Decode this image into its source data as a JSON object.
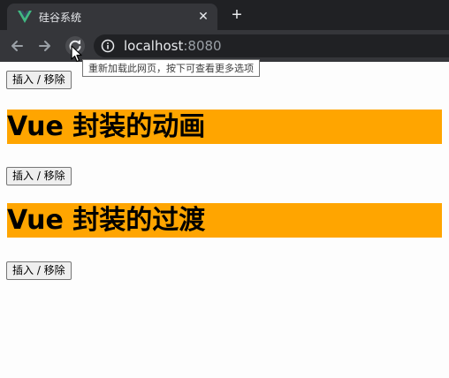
{
  "tab": {
    "title": "硅谷系统",
    "close_label": "✕",
    "new_tab_label": "+"
  },
  "omnibox": {
    "host": "localhost",
    "port": ":8080"
  },
  "tooltip": {
    "text": "重新加载此网页，按下可查看更多选项"
  },
  "page": {
    "buttons": [
      {
        "label": "插入 / 移除"
      },
      {
        "label": "插入 / 移除"
      },
      {
        "label": "插入 / 移除"
      }
    ],
    "headings": [
      {
        "text": "Vue 封装的动画"
      },
      {
        "text": "Vue 封装的过渡"
      }
    ]
  },
  "colors": {
    "heading_bg": "#ffa500",
    "vue_green": "#41b883",
    "vue_dark": "#35495e"
  }
}
